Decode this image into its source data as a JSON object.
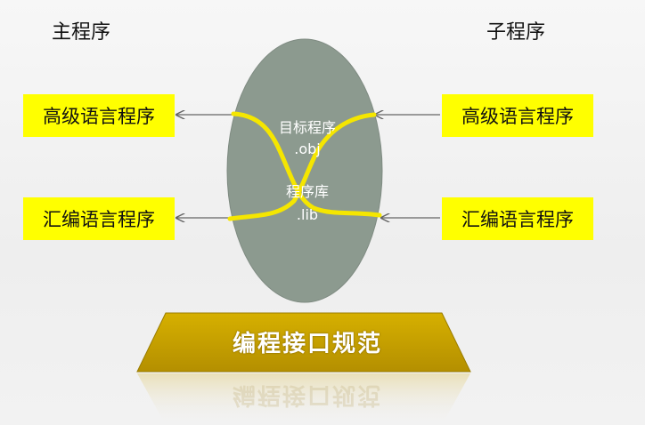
{
  "headings": {
    "main_program": "主程序",
    "sub_program": "子程序"
  },
  "left_boxes": {
    "high_level": "高级语言程序",
    "assembly": "汇编语言程序"
  },
  "right_boxes": {
    "high_level": "高级语言程序",
    "assembly": "汇编语言程序"
  },
  "oval": {
    "object_title": "目标程序",
    "object_ext": ".obj",
    "library_title": "程序库",
    "library_ext": ".lib"
  },
  "base": {
    "title": "编程接口规范"
  },
  "colors": {
    "label_fill": "#ffff00",
    "oval_fill": "#8c9a8f",
    "yellow_line": "#f5e600",
    "base_fill": "#c9a300",
    "arrow": "#666666"
  }
}
